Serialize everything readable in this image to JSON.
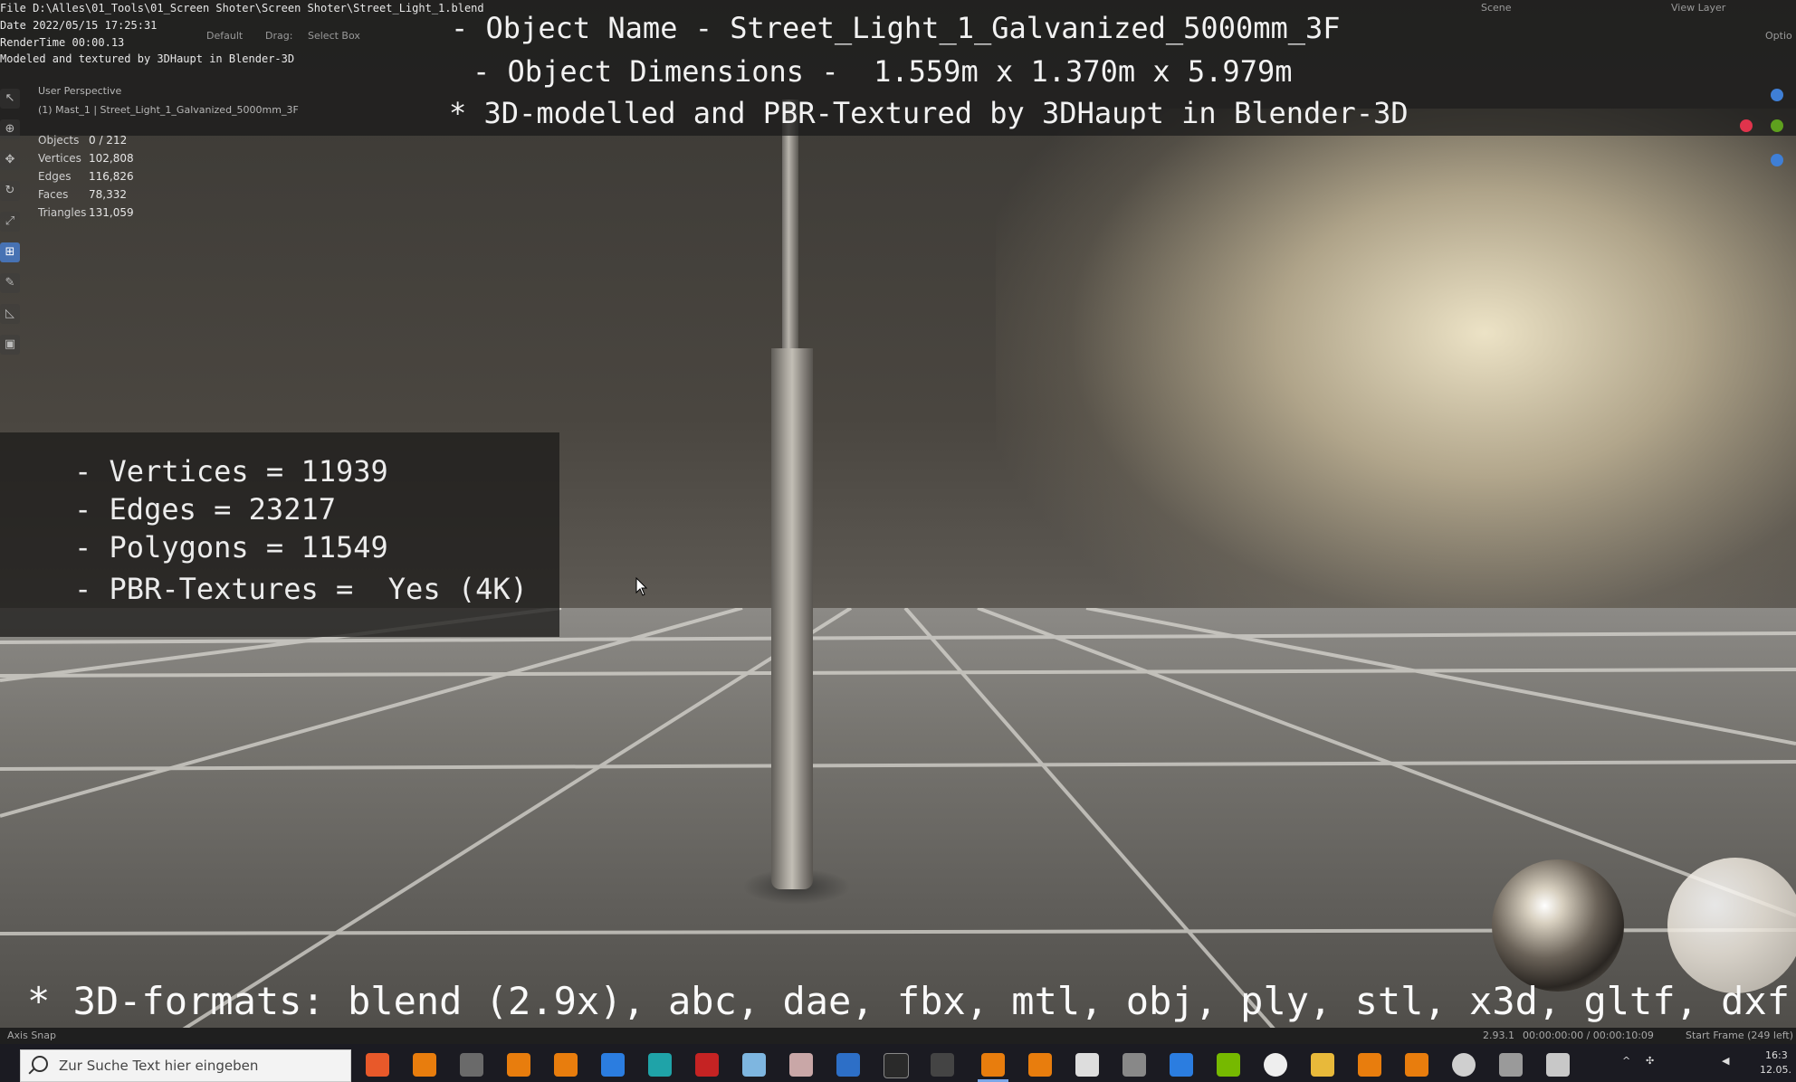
{
  "overlay_top": {
    "file": "File D:\\Alles\\01_Tools\\01_Screen Shoter\\Screen Shoter\\Street_Light_1.blend",
    "date": "Date 2022/05/15 17:25:31",
    "rendertime": "RenderTime 00:00.13",
    "modeled_by": "Modeled and textured by 3DHaupt in Blender-3D",
    "object_name": "- Object Name - Street_Light_1_Galvanized_5000mm_3F",
    "object_dimensions": "- Object Dimensions -  1.559m x 1.370m x 5.979m",
    "credit": "* 3D-modelled and PBR-Textured by 3DHaupt in Blender-3D"
  },
  "blender_header": {
    "orientation_value": "Default",
    "drag_label": "Drag:",
    "drag_value": "Select Box",
    "scene_label": "Scene",
    "view_layer_label": "View Layer",
    "options_label": "Optio"
  },
  "viewport": {
    "perspective_label": "User Perspective",
    "collection_label": "(1) Mast_1 | Street_Light_1_Galvanized_5000mm_3F"
  },
  "scene_stats": [
    {
      "key": "Objects",
      "value": "0 / 212"
    },
    {
      "key": "Vertices",
      "value": "102,808"
    },
    {
      "key": "Edges",
      "value": "116,826"
    },
    {
      "key": "Faces",
      "value": "78,332"
    },
    {
      "key": "Triangles",
      "value": "131,059"
    }
  ],
  "mesh_info": {
    "vertices": "- Vertices = 11939",
    "edges": "- Edges = 23217",
    "polygons": "- Polygons = 11549",
    "textures": "- PBR-Textures =  Yes (4K)"
  },
  "formats_caption": "* 3D-formats: blend (2.9x), abc, dae, fbx, mtl, obj, ply, stl, x3d, gltf, dxf",
  "statusbar": {
    "left": "Axis Snap",
    "version": "2.93.1",
    "timecode": "00:00:00:00 / 00:00:10:09",
    "frame": "Start Frame (249 left)"
  },
  "taskbar": {
    "search_placeholder": "Zur Suche Text hier eingeben",
    "clock_time": "16:3",
    "clock_date": "12.05."
  },
  "colors": {
    "active_tool": "#4772b3",
    "gizmo_x": "#e0344c",
    "gizmo_y": "#5ea01e",
    "gizmo_z": "#3f7fd6"
  }
}
